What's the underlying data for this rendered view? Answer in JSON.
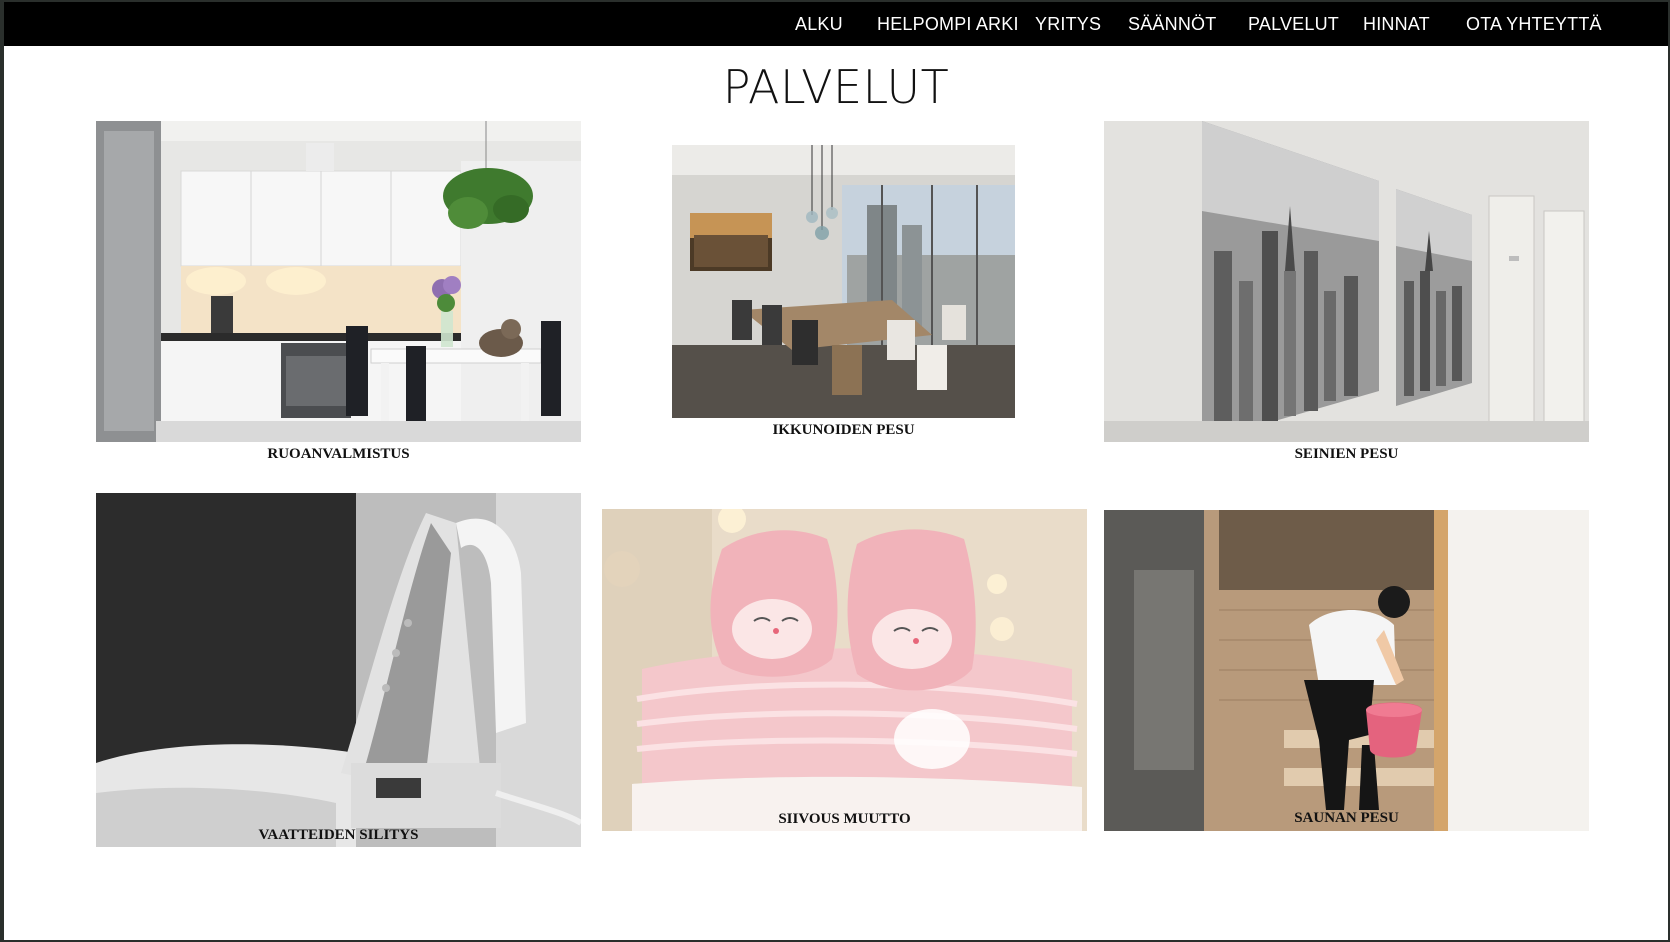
{
  "nav": {
    "items": [
      "ALKU",
      "HELPOMPI ARKI",
      "YRITYS",
      "SÄÄNNÖT",
      "PALVELUT",
      "HINNAT",
      "OTA YHTEYTTÄ"
    ]
  },
  "page": {
    "title": "PALVELUT"
  },
  "services": [
    {
      "caption": "RUOANVALMISTUS",
      "image": "kitchen-photo"
    },
    {
      "caption": "IKKUNOIDEN PESU",
      "image": "conference-room-photo"
    },
    {
      "caption": "SEINIEN PESU",
      "image": "city-canvas-photo"
    },
    {
      "caption": "VAATTEIDEN SILITYS",
      "image": "iron-photo"
    },
    {
      "caption": "SIIVOUS MUUTTO",
      "image": "baby-shoes-photo"
    },
    {
      "caption": "SAUNAN PESU",
      "image": "sauna-cleaning-photo"
    }
  ],
  "colors": {
    "nav_bg": "#000000",
    "nav_text": "#ffffff",
    "page_bg": "#ffffff",
    "frame": "#2a2f2c"
  }
}
